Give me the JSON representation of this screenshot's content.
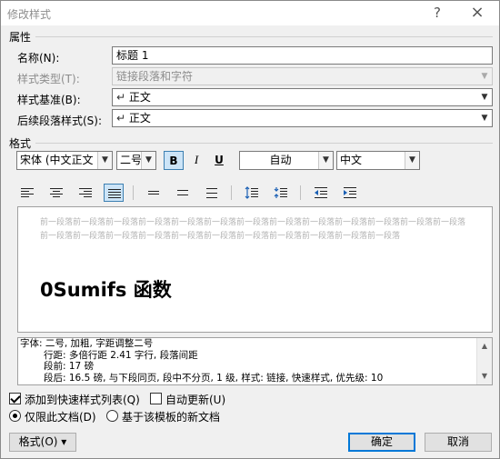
{
  "window": {
    "title": "修改样式",
    "help": "?",
    "close": "×"
  },
  "properties": {
    "section": "属性",
    "name_label": "名称(N):",
    "name_value": "标题 1",
    "style_type_label": "样式类型(T):",
    "style_type_value": "链接段落和字符",
    "based_on_label": "样式基准(B):",
    "based_on_value": "正文",
    "following_label": "后续段落样式(S):",
    "following_value": "正文",
    "para_mark": "↵"
  },
  "formatting": {
    "section": "格式",
    "font": "宋体 (中文正文",
    "size": "二号",
    "bold": "B",
    "italic": "I",
    "underline": "U",
    "color": "自动",
    "language": "中文"
  },
  "preview": {
    "prev_paragraph": "前一段落前一段落前一段落前一段落前一段落前一段落前一段落前一段落前一段落前一段落前一段落前一段落前一段落前一段落前一段落前一段落前一段落前一段落前一段落前一段落前一段落前一段落前一段落前一段落",
    "heading": "0Sumifs 函数"
  },
  "description": {
    "line1": "字体: 二号, 加粗, 字距调整二号",
    "line2": "行距: 多倍行距 2.41 字行, 段落间距",
    "line3": "段前: 17 磅",
    "line4": "段后: 16.5 磅, 与下段同页, 段中不分页, 1 级, 样式: 链接, 快速样式, 优先级: 10"
  },
  "options": {
    "add_to_gallery": "添加到快速样式列表(Q)",
    "add_to_gallery_checked": true,
    "auto_update": "自动更新(U)",
    "auto_update_checked": false,
    "only_this_doc": "仅限此文档(D)",
    "only_this_doc_selected": true,
    "new_docs": "基于该模板的新文档",
    "new_docs_selected": false
  },
  "buttons": {
    "format": "格式(O)",
    "format_arrow": "▾",
    "ok": "确定",
    "cancel": "取消"
  },
  "colors": {
    "accent": "#0078d7",
    "active_bg": "#cce4f7",
    "active_border": "#3c7fb1"
  }
}
